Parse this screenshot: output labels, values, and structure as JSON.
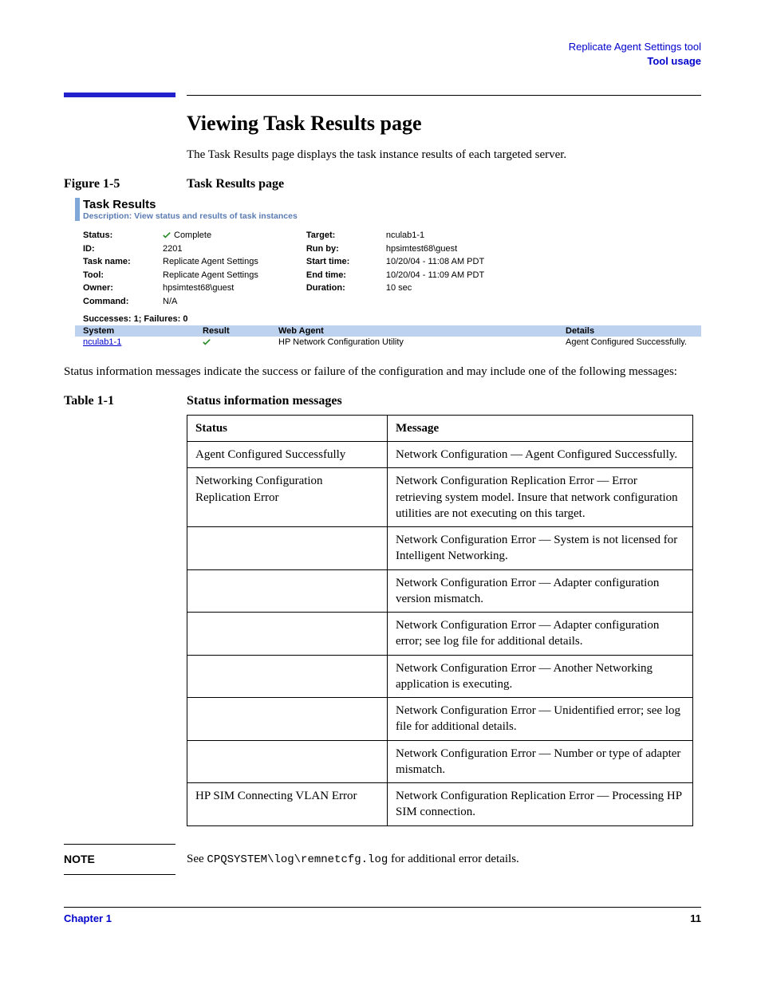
{
  "header": {
    "line1": "Replicate Agent Settings tool",
    "line2": "Tool usage"
  },
  "section": {
    "title": "Viewing Task Results page",
    "intro": "The Task Results page displays the task instance results of each targeted server."
  },
  "figure": {
    "label": "Figure 1-5",
    "caption": "Task Results page"
  },
  "taskResults": {
    "title": "Task Results",
    "description": "Description: View status and results of task instances",
    "left": {
      "statusK": "Status:",
      "statusV": "Complete",
      "idK": "ID:",
      "idV": "2201",
      "taskNameK": "Task name:",
      "taskNameV": "Replicate Agent Settings",
      "toolK": "Tool:",
      "toolV": "Replicate Agent Settings",
      "ownerK": "Owner:",
      "ownerV": "hpsimtest68\\guest",
      "commandK": "Command:",
      "commandV": "N/A"
    },
    "right": {
      "targetK": "Target:",
      "targetV": "nculab1-1",
      "runByK": "Run by:",
      "runByV": "hpsimtest68\\guest",
      "startK": "Start time:",
      "startV": "10/20/04 - 11:08 AM PDT",
      "endK": "End time:",
      "endV": "10/20/04 - 11:09 AM PDT",
      "durK": "Duration:",
      "durV": "10 sec"
    },
    "summary": "Successes: 1; Failures: 0",
    "cols": {
      "system": "System",
      "result": "Result",
      "webAgent": "Web Agent",
      "details": "Details"
    },
    "row": {
      "system": "nculab1-1",
      "webAgent": "HP Network Configuration Utility",
      "details": "Agent Configured Successfully."
    }
  },
  "paraAfterFigure": "Status information messages indicate the success or failure of the configuration and may include one of the following messages:",
  "table": {
    "label": "Table 1-1",
    "caption": "Status information messages",
    "head": {
      "status": "Status",
      "message": "Message"
    },
    "rows": [
      {
        "status": "Agent Configured Successfully",
        "message": "Network Configuration — Agent Configured Successfully."
      },
      {
        "status": "Networking Configuration Replication Error",
        "message": "Network Configuration Replication Error — Error retrieving system model. Insure that network configuration utilities are not executing on this target."
      },
      {
        "status": "",
        "message": "Network Configuration Error — System is not licensed for Intelligent Networking."
      },
      {
        "status": "",
        "message": "Network Configuration Error — Adapter configuration version mismatch."
      },
      {
        "status": "",
        "message": "Network Configuration Error — Adapter configuration error; see log file for additional details."
      },
      {
        "status": "",
        "message": "Network Configuration Error — Another Networking application is executing."
      },
      {
        "status": "",
        "message": "Network Configuration Error — Unidentified error; see log file for additional details."
      },
      {
        "status": "",
        "message": "Network Configuration Error — Number or type of adapter mismatch."
      },
      {
        "status": "HP SIM Connecting VLAN Error",
        "message": "Network Configuration Replication Error — Processing HP SIM connection."
      }
    ]
  },
  "note": {
    "label": "NOTE",
    "pre": "See ",
    "code": "CPQSYSTEM\\log\\remnetcfg.log",
    "post": " for additional error details."
  },
  "footer": {
    "left": "Chapter 1",
    "right": "11"
  }
}
